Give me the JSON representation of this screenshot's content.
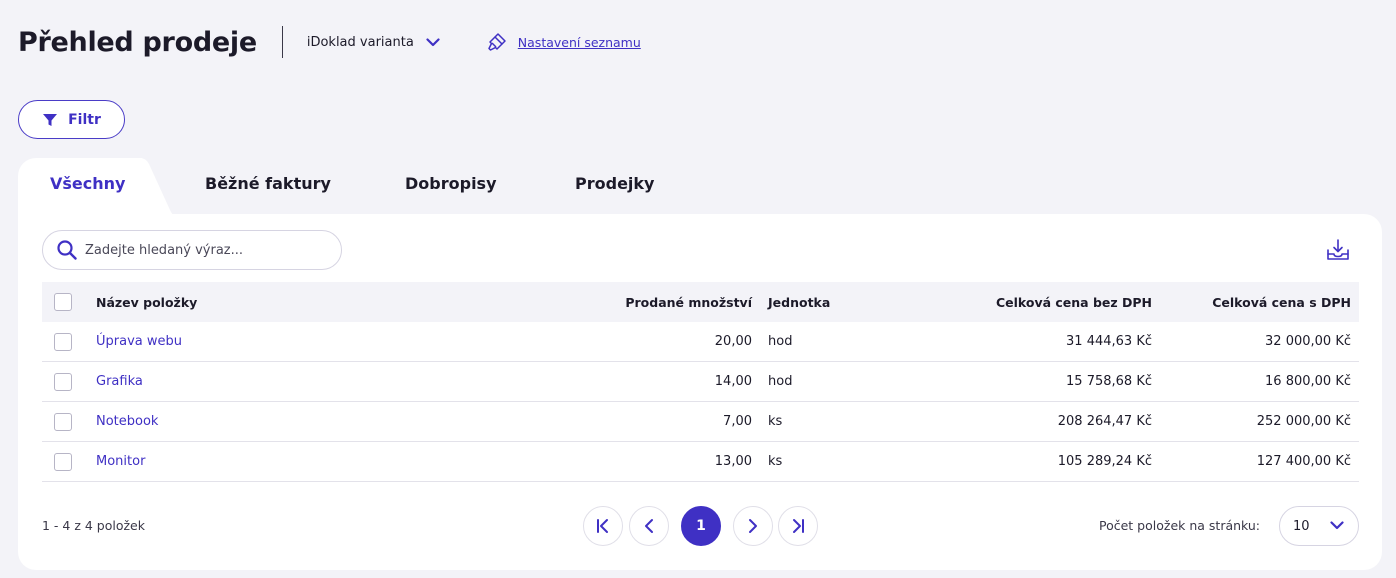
{
  "header": {
    "title": "Přehled prodeje",
    "variant": "iDoklad varianta",
    "settings_link": "Nastavení seznamu"
  },
  "filter": {
    "label": "Filtr"
  },
  "tabs": [
    {
      "label": "Všechny",
      "active": true
    },
    {
      "label": "Běžné faktury",
      "active": false
    },
    {
      "label": "Dobropisy",
      "active": false
    },
    {
      "label": "Prodejky",
      "active": false
    }
  ],
  "search": {
    "placeholder": "Zadejte hledaný výraz...",
    "value": ""
  },
  "table": {
    "columns": [
      "Název položky",
      "Prodané množství",
      "Jednotka",
      "Celková cena bez DPH",
      "Celková cena s DPH"
    ],
    "rows": [
      {
        "name": "Úprava webu",
        "qty": "20,00",
        "unit": "hod",
        "net": "31 444,63 Kč",
        "gross": "32 000,00 Kč"
      },
      {
        "name": "Grafika",
        "qty": "14,00",
        "unit": "hod",
        "net": "15 758,68 Kč",
        "gross": "16 800,00 Kč"
      },
      {
        "name": "Notebook",
        "qty": "7,00",
        "unit": "ks",
        "net": "208 264,47 Kč",
        "gross": "252 000,00 Kč"
      },
      {
        "name": "Monitor",
        "qty": "13,00",
        "unit": "ks",
        "net": "105 289,24 Kč",
        "gross": "127 400,00 Kč"
      }
    ]
  },
  "footer": {
    "count_text": "1 - 4 z 4 položek",
    "current_page": "1",
    "per_page_label": "Počet položek na stránku:",
    "per_page_value": "10"
  },
  "colors": {
    "accent": "#3f30c4",
    "background": "#f3f3f8",
    "surface": "#ffffff"
  },
  "icons": [
    "chevron-down-icon",
    "brush-icon",
    "filter-icon",
    "search-icon",
    "download-icon",
    "first-page-icon",
    "prev-page-icon",
    "next-page-icon",
    "last-page-icon"
  ]
}
